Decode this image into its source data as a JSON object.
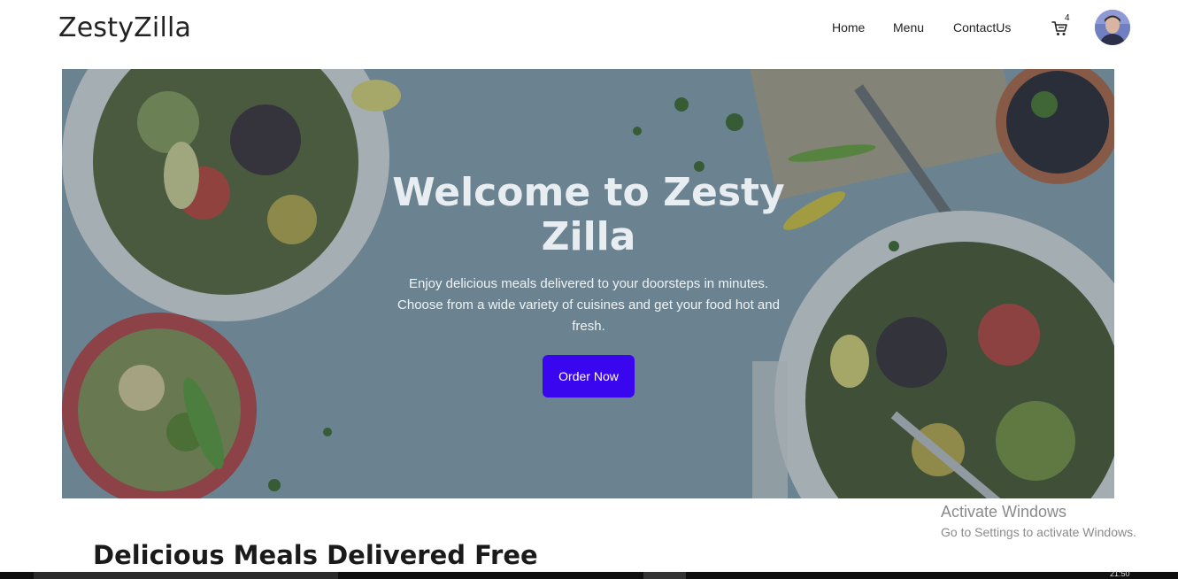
{
  "navbar": {
    "brand": "ZestyZilla",
    "links": [
      {
        "label": "Home"
      },
      {
        "label": "Menu"
      },
      {
        "label": "ContactUs"
      }
    ],
    "cart": {
      "count": "4",
      "icon": "cart-icon"
    },
    "avatar": {
      "icon": "user-avatar"
    }
  },
  "hero": {
    "title": "Welcome to Zesty Zilla",
    "subtitle": "Enjoy delicious meals delivered to your doorsteps in minutes. Choose from a wide variety of cuisines and get your food hot and fresh.",
    "button_label": "Order Now",
    "colors": {
      "button": "#3a06f0",
      "overlay": "#2c3e4b"
    }
  },
  "section": {
    "title": "Delicious Meals Delivered Free"
  },
  "watermark": {
    "title": "Activate Windows",
    "subtitle": "Go to Settings to activate Windows."
  },
  "taskbar": {
    "clock": "21:50"
  }
}
